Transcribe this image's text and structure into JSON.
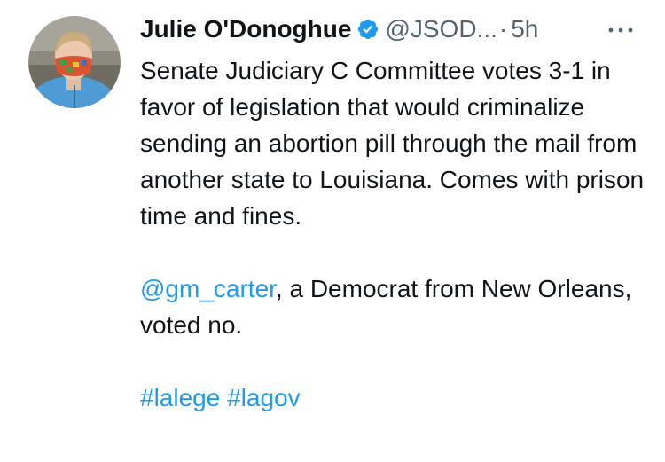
{
  "tweet": {
    "author": {
      "name": "Julie O'Donoghue",
      "handle": "@JSOD...",
      "separator": "·",
      "time": "5h",
      "avatar_icon": "profile-photo",
      "verified_icon": "verified-badge-icon"
    },
    "more_icon": "more-horizontal-icon",
    "text": {
      "p1": "Senate Judiciary C Committee votes 3-1 in favor of legislation that would criminalize sending an abortion pill through the mail from another state to Louisiana. Comes with prison time and fines.",
      "p2_mention": "@gm_carter",
      "p2_rest": ", a Democrat from New Orleans, voted no.",
      "hashtag1": "#lalege",
      "hashtag_space": " ",
      "hashtag2": "#lagov"
    }
  },
  "colors": {
    "text": "#0f1419",
    "secondary": "#536471",
    "link": "#1d9bf0",
    "verified": "#1d9bf0"
  }
}
